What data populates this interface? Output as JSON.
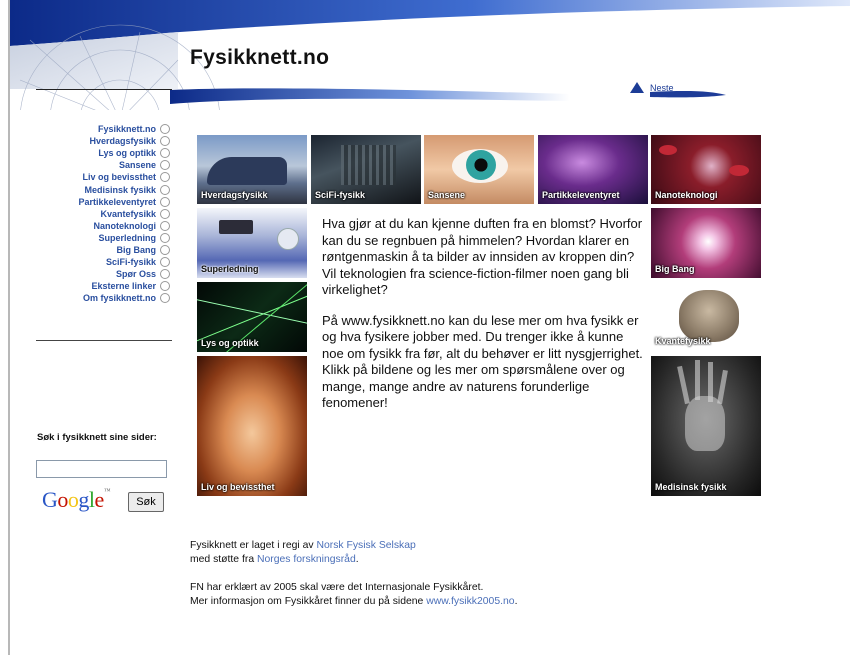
{
  "header": {
    "title": "Fysikknett.no",
    "next_label": "Neste",
    "accent_color": "#2f58b8"
  },
  "sidebar": {
    "items": [
      {
        "label": "Fysikknett.no"
      },
      {
        "label": "Hverdagsfysikk"
      },
      {
        "label": "Lys og optikk"
      },
      {
        "label": "Sansene"
      },
      {
        "label": "Liv og bevissthet"
      },
      {
        "label": "Medisinsk fysikk"
      },
      {
        "label": "Partikkeleventyret"
      },
      {
        "label": "Kvantefysikk"
      },
      {
        "label": "Nanoteknologi"
      },
      {
        "label": "Superledning"
      },
      {
        "label": "Big Bang"
      },
      {
        "label": "SciFi-fysikk"
      },
      {
        "label": "Spør Oss"
      },
      {
        "label": "Eksterne linker"
      },
      {
        "label": "Om fysikknett.no"
      }
    ]
  },
  "search": {
    "label": "Søk i fysikknett sine sider:",
    "value": "",
    "logo_text": "Google",
    "button_label": "Søk"
  },
  "tiles": {
    "hverdagsfysikk": "Hverdagsfysikk",
    "scifi": "SciFi-fysikk",
    "sansene": "Sansene",
    "partikkeleventyret": "Partikkeleventyret",
    "nanoteknologi": "Nanoteknologi",
    "superledning": "Superledning",
    "bigbang": "Big Bang",
    "lys": "Lys og optikk",
    "kvantefysikk": "Kvantefysikk",
    "liv": "Liv og bevissthet",
    "medisinsk": "Medisinsk fysikk"
  },
  "main": {
    "paragraph1": "Hva gjør at du kan kjenne duften fra en blomst? Hvorfor kan du se regnbuen på himmelen? Hvordan klarer en røntgenmaskin å ta bilder av innsiden av kroppen din? Vil teknologien fra science-fiction-filmer noen gang bli virkelighet?",
    "paragraph2": "På www.fysikknett.no kan du lese mer om hva fysikk er og hva fysikere jobber med. Du trenger ikke å kunne noe om fysikk fra før, alt du behøver er litt nysgjerrighet. Klikk på bildene og les mer om spørsmålene over og mange, mange andre av naturens forunderlige fenomener!"
  },
  "footer": {
    "line1_prefix": "Fysikknett er laget i regi av ",
    "line1_link": "Norsk Fysisk Selskap",
    "line2_prefix": "med støtte fra ",
    "line2_link": "Norges forskningsråd",
    "line2_suffix": ".",
    "line3": "FN har erklært av 2005 skal være det Internasjonale Fysikkåret.",
    "line4_prefix": "Mer informasjon om Fysikkåret finner du på sidene ",
    "line4_link": "www.fysikk2005.no",
    "line4_suffix": "."
  }
}
